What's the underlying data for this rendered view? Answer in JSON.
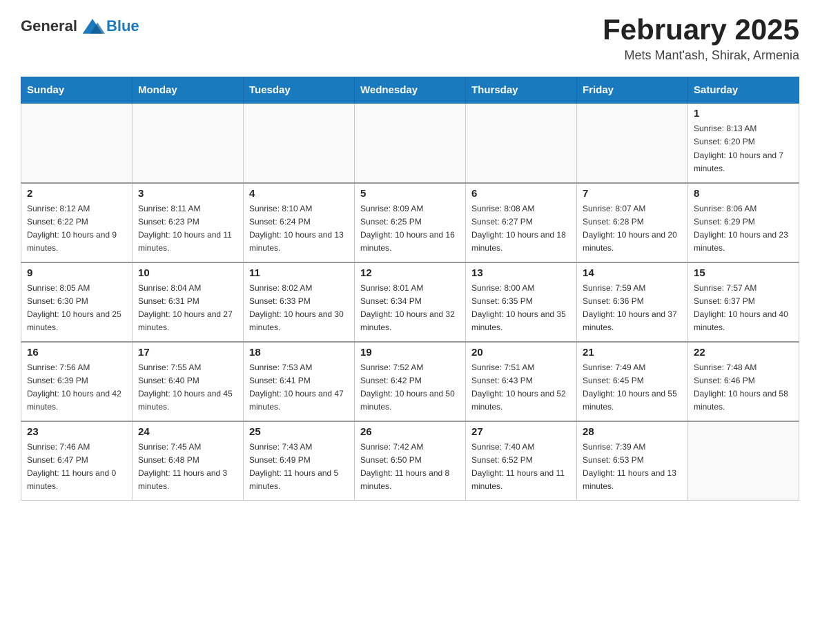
{
  "logo": {
    "general": "General",
    "blue": "Blue"
  },
  "title": "February 2025",
  "subtitle": "Mets Mant'ash, Shirak, Armenia",
  "days_header": [
    "Sunday",
    "Monday",
    "Tuesday",
    "Wednesday",
    "Thursday",
    "Friday",
    "Saturday"
  ],
  "weeks": [
    [
      {
        "day": "",
        "info": ""
      },
      {
        "day": "",
        "info": ""
      },
      {
        "day": "",
        "info": ""
      },
      {
        "day": "",
        "info": ""
      },
      {
        "day": "",
        "info": ""
      },
      {
        "day": "",
        "info": ""
      },
      {
        "day": "1",
        "info": "Sunrise: 8:13 AM\nSunset: 6:20 PM\nDaylight: 10 hours and 7 minutes."
      }
    ],
    [
      {
        "day": "2",
        "info": "Sunrise: 8:12 AM\nSunset: 6:22 PM\nDaylight: 10 hours and 9 minutes."
      },
      {
        "day": "3",
        "info": "Sunrise: 8:11 AM\nSunset: 6:23 PM\nDaylight: 10 hours and 11 minutes."
      },
      {
        "day": "4",
        "info": "Sunrise: 8:10 AM\nSunset: 6:24 PM\nDaylight: 10 hours and 13 minutes."
      },
      {
        "day": "5",
        "info": "Sunrise: 8:09 AM\nSunset: 6:25 PM\nDaylight: 10 hours and 16 minutes."
      },
      {
        "day": "6",
        "info": "Sunrise: 8:08 AM\nSunset: 6:27 PM\nDaylight: 10 hours and 18 minutes."
      },
      {
        "day": "7",
        "info": "Sunrise: 8:07 AM\nSunset: 6:28 PM\nDaylight: 10 hours and 20 minutes."
      },
      {
        "day": "8",
        "info": "Sunrise: 8:06 AM\nSunset: 6:29 PM\nDaylight: 10 hours and 23 minutes."
      }
    ],
    [
      {
        "day": "9",
        "info": "Sunrise: 8:05 AM\nSunset: 6:30 PM\nDaylight: 10 hours and 25 minutes."
      },
      {
        "day": "10",
        "info": "Sunrise: 8:04 AM\nSunset: 6:31 PM\nDaylight: 10 hours and 27 minutes."
      },
      {
        "day": "11",
        "info": "Sunrise: 8:02 AM\nSunset: 6:33 PM\nDaylight: 10 hours and 30 minutes."
      },
      {
        "day": "12",
        "info": "Sunrise: 8:01 AM\nSunset: 6:34 PM\nDaylight: 10 hours and 32 minutes."
      },
      {
        "day": "13",
        "info": "Sunrise: 8:00 AM\nSunset: 6:35 PM\nDaylight: 10 hours and 35 minutes."
      },
      {
        "day": "14",
        "info": "Sunrise: 7:59 AM\nSunset: 6:36 PM\nDaylight: 10 hours and 37 minutes."
      },
      {
        "day": "15",
        "info": "Sunrise: 7:57 AM\nSunset: 6:37 PM\nDaylight: 10 hours and 40 minutes."
      }
    ],
    [
      {
        "day": "16",
        "info": "Sunrise: 7:56 AM\nSunset: 6:39 PM\nDaylight: 10 hours and 42 minutes."
      },
      {
        "day": "17",
        "info": "Sunrise: 7:55 AM\nSunset: 6:40 PM\nDaylight: 10 hours and 45 minutes."
      },
      {
        "day": "18",
        "info": "Sunrise: 7:53 AM\nSunset: 6:41 PM\nDaylight: 10 hours and 47 minutes."
      },
      {
        "day": "19",
        "info": "Sunrise: 7:52 AM\nSunset: 6:42 PM\nDaylight: 10 hours and 50 minutes."
      },
      {
        "day": "20",
        "info": "Sunrise: 7:51 AM\nSunset: 6:43 PM\nDaylight: 10 hours and 52 minutes."
      },
      {
        "day": "21",
        "info": "Sunrise: 7:49 AM\nSunset: 6:45 PM\nDaylight: 10 hours and 55 minutes."
      },
      {
        "day": "22",
        "info": "Sunrise: 7:48 AM\nSunset: 6:46 PM\nDaylight: 10 hours and 58 minutes."
      }
    ],
    [
      {
        "day": "23",
        "info": "Sunrise: 7:46 AM\nSunset: 6:47 PM\nDaylight: 11 hours and 0 minutes."
      },
      {
        "day": "24",
        "info": "Sunrise: 7:45 AM\nSunset: 6:48 PM\nDaylight: 11 hours and 3 minutes."
      },
      {
        "day": "25",
        "info": "Sunrise: 7:43 AM\nSunset: 6:49 PM\nDaylight: 11 hours and 5 minutes."
      },
      {
        "day": "26",
        "info": "Sunrise: 7:42 AM\nSunset: 6:50 PM\nDaylight: 11 hours and 8 minutes."
      },
      {
        "day": "27",
        "info": "Sunrise: 7:40 AM\nSunset: 6:52 PM\nDaylight: 11 hours and 11 minutes."
      },
      {
        "day": "28",
        "info": "Sunrise: 7:39 AM\nSunset: 6:53 PM\nDaylight: 11 hours and 13 minutes."
      },
      {
        "day": "",
        "info": ""
      }
    ]
  ]
}
